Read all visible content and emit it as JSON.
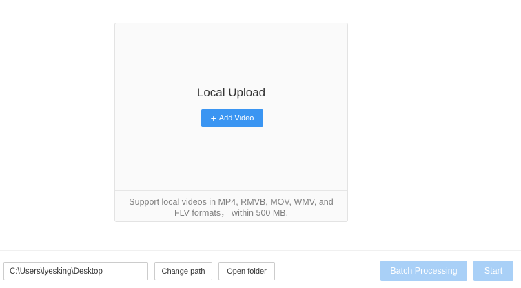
{
  "upload": {
    "title": "Local Upload",
    "add_button_icon": "plus-icon",
    "add_button_plus": "+",
    "add_button_label": "Add Video",
    "support_text": "Support local videos in MP4, RMVB, MOV, WMV, and FLV formats， within 500 MB."
  },
  "footer": {
    "path_value": "C:\\Users\\lyesking\\Desktop",
    "change_path_label": "Change path",
    "open_folder_label": "Open folder",
    "batch_processing_label": "Batch Processing",
    "start_label": "Start"
  },
  "colors": {
    "accent": "#3a95f2",
    "accent_disabled": "#a9d0f7",
    "border": "#cccccc",
    "panel_bg": "#fafafa",
    "muted_text": "#808080"
  }
}
